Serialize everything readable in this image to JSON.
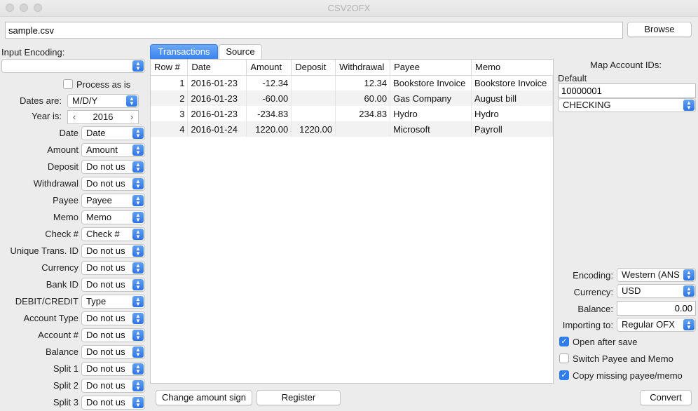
{
  "window": {
    "title": "CSV2OFX"
  },
  "file": {
    "path": "sample.csv",
    "browse_label": "Browse"
  },
  "left": {
    "input_encoding_label": "Input Encoding:",
    "input_encoding_value": "",
    "process_as_is_label": "Process as is",
    "dates_are_label": "Dates are:",
    "dates_are_value": "M/D/Y",
    "year_is_label": "Year is:",
    "year_value": "2016",
    "mappings": [
      {
        "label": "Date",
        "value": "Date"
      },
      {
        "label": "Amount",
        "value": "Amount"
      },
      {
        "label": "Deposit",
        "value": "Do not us"
      },
      {
        "label": "Withdrawal",
        "value": "Do not us"
      },
      {
        "label": "Payee",
        "value": "Payee"
      },
      {
        "label": "Memo",
        "value": "Memo"
      },
      {
        "label": "Check #",
        "value": "Check #"
      },
      {
        "label": "Unique Trans. ID",
        "value": "Do not us"
      },
      {
        "label": "Currency",
        "value": "Do not us"
      },
      {
        "label": "Bank ID",
        "value": "Do not us"
      },
      {
        "label": "DEBIT/CREDIT",
        "value": "Type"
      },
      {
        "label": "Account Type",
        "value": "Do not us"
      },
      {
        "label": "Account #",
        "value": "Do not us"
      },
      {
        "label": "Balance",
        "value": "Do not us"
      },
      {
        "label": "Split 1",
        "value": "Do not us"
      },
      {
        "label": "Split 2",
        "value": "Do not us"
      },
      {
        "label": "Split 3",
        "value": "Do not us"
      }
    ]
  },
  "tabs": [
    {
      "label": "Transactions",
      "active": true
    },
    {
      "label": "Source",
      "active": false
    }
  ],
  "table": {
    "columns": [
      "Row #",
      "Date",
      "Amount",
      "Deposit",
      "Withdrawal",
      "Payee",
      "Memo"
    ],
    "rows": [
      [
        "1",
        "2016-01-23",
        "-12.34",
        "",
        "12.34",
        "Bookstore Invoice",
        "Bookstore Invoice"
      ],
      [
        "2",
        "2016-01-23",
        "-60.00",
        "",
        "60.00",
        "Gas Company",
        "August bill"
      ],
      [
        "3",
        "2016-01-23",
        "-234.83",
        "",
        "234.83",
        "Hydro",
        "Hydro"
      ],
      [
        "4",
        "2016-01-24",
        "1220.00",
        "1220.00",
        "",
        "Microsoft",
        "Payroll"
      ]
    ]
  },
  "right": {
    "map_account_ids_label": "Map Account IDs:",
    "default_label": "Default",
    "account_id_value": "10000001",
    "account_type_value": "CHECKING",
    "encoding_label": "Encoding:",
    "encoding_value": "Western (ANS",
    "currency_label": "Currency:",
    "currency_value": "USD",
    "balance_label": "Balance:",
    "balance_value": "0.00",
    "importing_to_label": "Importing to:",
    "importing_to_value": "Regular OFX",
    "open_after_save_label": "Open after save",
    "open_after_save_checked": true,
    "switch_payee_memo_label": "Switch Payee and Memo",
    "switch_payee_memo_checked": false,
    "copy_missing_label": "Copy missing payee/memo",
    "copy_missing_checked": true
  },
  "bottom": {
    "change_sign_label": "Change amount sign",
    "register_label": "Register",
    "convert_label": "Convert"
  },
  "colors": {
    "accent": "#3a82ee",
    "window_bg": "#ececec"
  }
}
